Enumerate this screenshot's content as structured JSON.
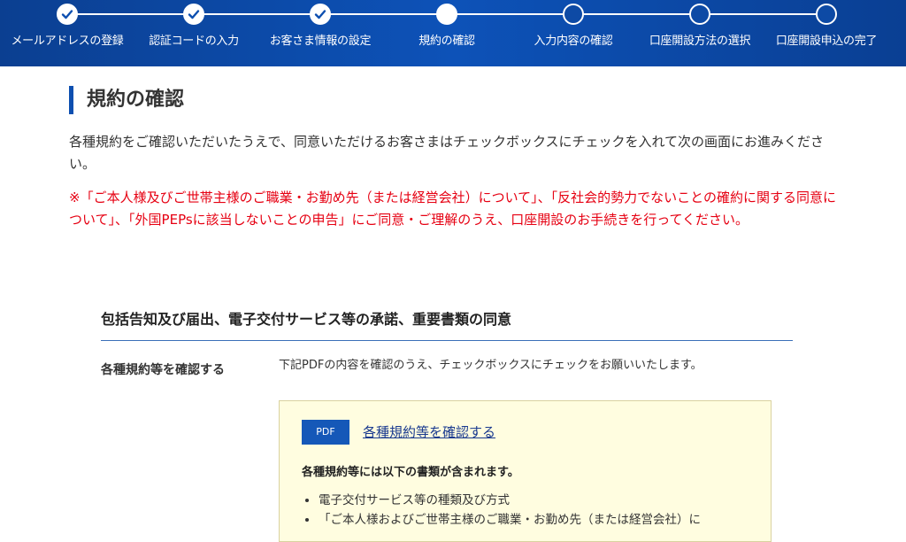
{
  "stepper": {
    "steps": [
      {
        "label": "メールアドレスの登録",
        "state": "done"
      },
      {
        "label": "認証コードの入力",
        "state": "done"
      },
      {
        "label": "お客さま情報の設定",
        "state": "done"
      },
      {
        "label": "規約の確認",
        "state": "current"
      },
      {
        "label": "入力内容の確認",
        "state": "todo"
      },
      {
        "label": "口座開設方法の選択",
        "state": "todo"
      },
      {
        "label": "口座開設申込の完了",
        "state": "todo"
      }
    ],
    "done_icon": "check-icon",
    "colors": {
      "background": "#0d4fb0",
      "foreground": "#ffffff"
    }
  },
  "page": {
    "title": "規約の確認",
    "intro": "各種規約をご確認いただいたうえで、同意いただけるお客さまはチェックボックスにチェックを入れて次の画面にお進みください。",
    "notice": "※「ご本人様及びご世帯主様のご職業・お勤め先（または経営会社）について」、「反社会的勢力でないことの確約に関する同意について」、「外国PEPsに該当しないことの申告」にご同意・ご理解のうえ、口座開設のお手続きを行ってください。",
    "notice_color": "#e60012"
  },
  "section": {
    "title": "包括告知及び届出、電子交付サービス等の承諾、重要書類の同意",
    "row_label": "各種規約等を確認する",
    "row_desc": "下記PDFの内容を確認のうえ、チェックボックスにチェックをお願いいたします。",
    "box": {
      "pdf_badge": "PDF",
      "link_text": "各種規約等を確認する",
      "heading": "各種規約等には以下の書類が含まれます。",
      "items": [
        "電子交付サービス等の種類及び方式",
        "「ご本人様およびご世帯主様のご職業・お勤め先（または経営会社）に"
      ],
      "background": "#fffde0"
    }
  }
}
